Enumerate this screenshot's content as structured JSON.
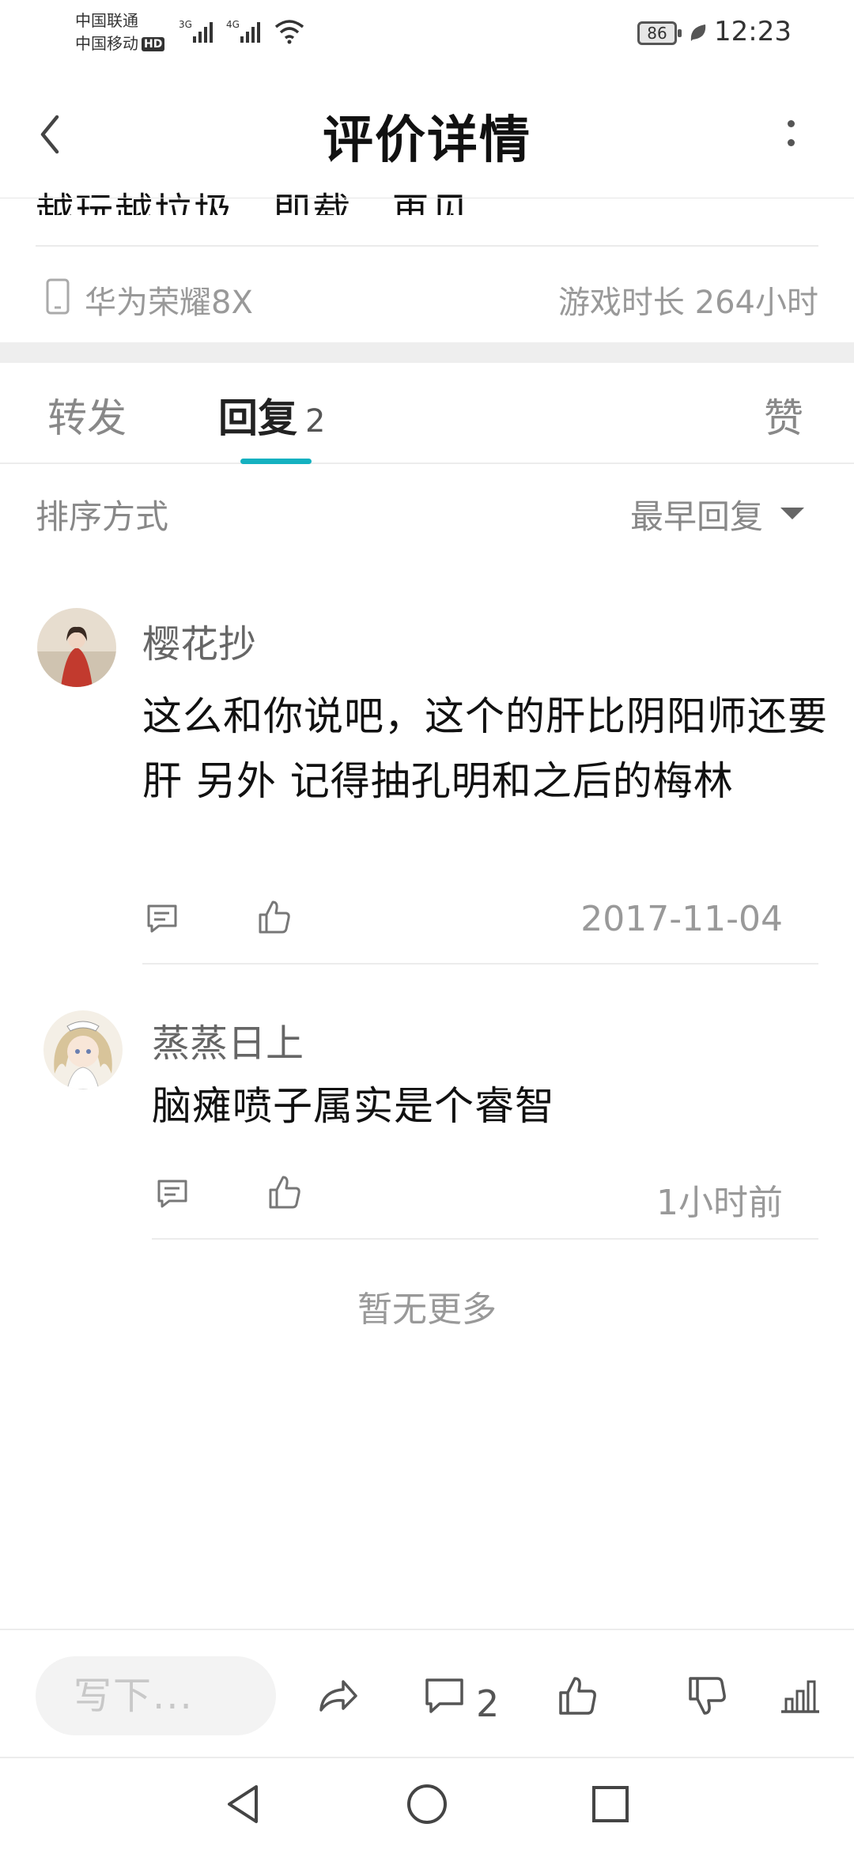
{
  "status_bar": {
    "carrier1": "中国联通",
    "carrier2": "中国移动",
    "hd_badge": "HD",
    "signal1_type": "3G",
    "signal2_type": "4G",
    "battery": "86",
    "time": "12:23"
  },
  "header": {
    "title": "评价详情"
  },
  "review": {
    "clipped_text": "越玩越垃圾，即载，再见",
    "device": "华为荣耀8X",
    "play_time": "游戏时长 264小时"
  },
  "tabs": [
    {
      "label": "转发"
    },
    {
      "label": "回复",
      "count": "2"
    },
    {
      "label": "赞"
    }
  ],
  "sort": {
    "label": "排序方式",
    "value": "最早回复"
  },
  "comments": [
    {
      "name": "樱花抄",
      "text": "这么和你说吧，这个的肝比阴阳师还要肝 另外 记得抽孔明和之后的梅林",
      "date": "2017-11-04"
    },
    {
      "name": "蒸蒸日上",
      "text": "脑瘫喷子属实是个睿智",
      "date": "1小时前"
    }
  ],
  "no_more": "暂无更多",
  "bottom_bar": {
    "input_placeholder": "写下...",
    "reply_count": "2"
  },
  "colors": {
    "accent": "#14b1c0",
    "text_primary": "#111111",
    "text_secondary": "#999999"
  }
}
